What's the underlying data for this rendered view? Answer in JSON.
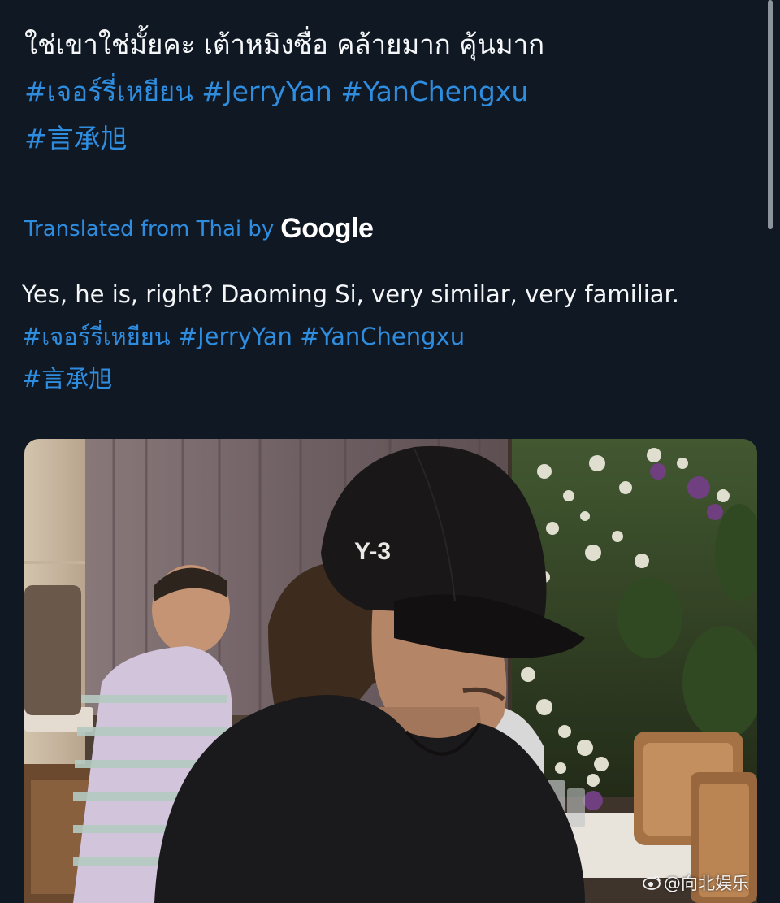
{
  "post": {
    "original_text": "ใช่เขาใช่มั้ยคะ เต้าหมิงซื่อ  คล้ายมาก คุ้นมาก",
    "original_hashtags_line1": [
      "#เจอร์รี่เหยียน",
      "#JerryYan",
      "#YanChengxu"
    ],
    "original_hashtags_line2": [
      "#言承旭"
    ],
    "translated_from_label": "Translated from Thai by",
    "translation_provider": "Google",
    "translated_text": "Yes, he is, right? Daoming Si, very similar, very familiar.",
    "translated_hashtags_line1": [
      "#เจอร์รี่เหยียน",
      "#JerryYan",
      "#YanChengxu"
    ],
    "translated_hashtags_line2": [
      "#言承旭"
    ]
  },
  "photo": {
    "cap_logo_text": "Y-3",
    "watermark_text": "@向北娱乐",
    "watermark_icon": "weibo-eye-icon"
  },
  "colors": {
    "background": "#0f1823",
    "hashtag": "#2f8de0",
    "text": "#f4f6f8"
  }
}
